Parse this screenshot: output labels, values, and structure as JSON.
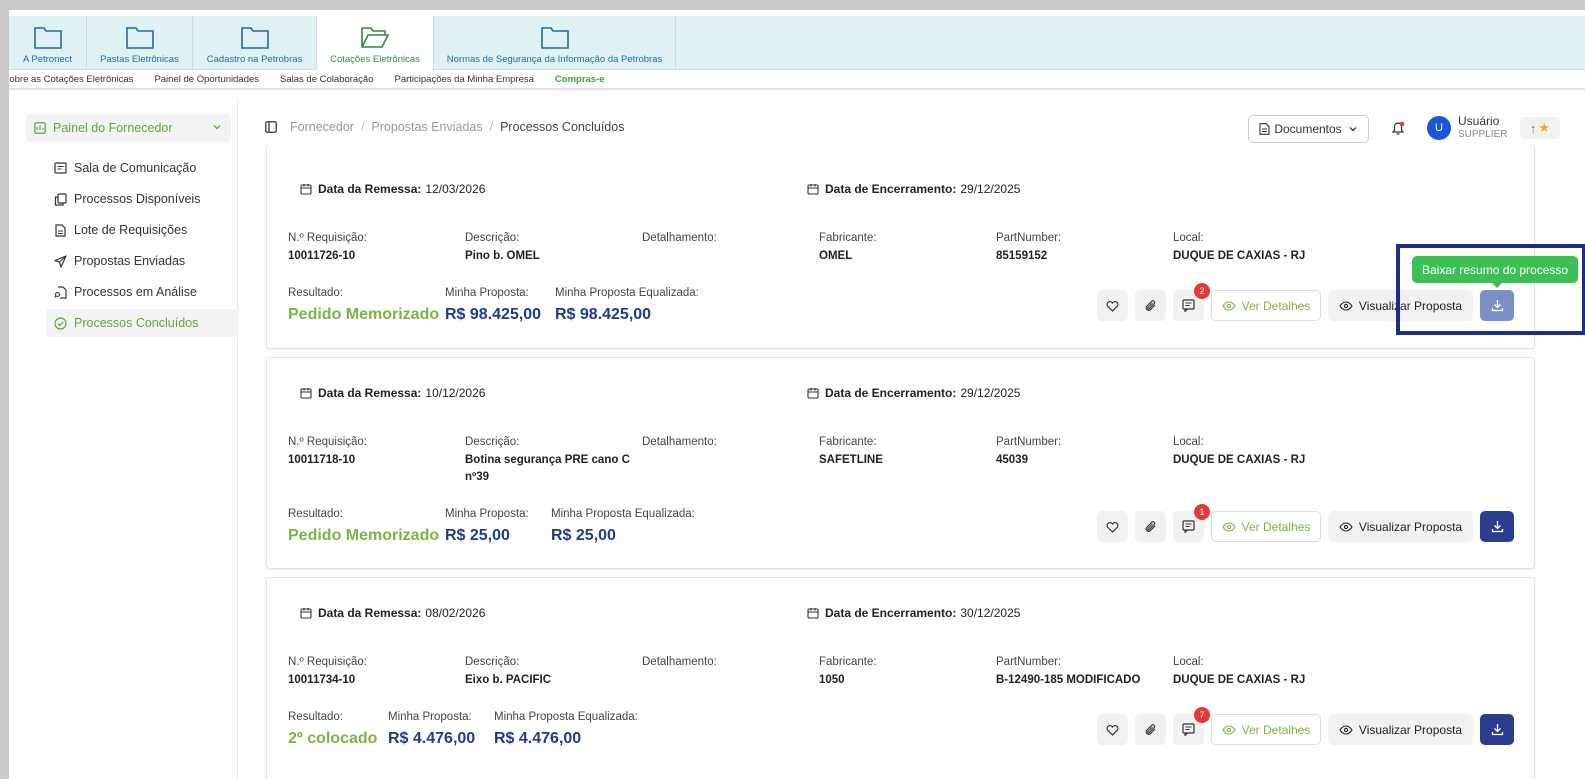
{
  "top_tabs": [
    {
      "label": "A Petronect"
    },
    {
      "label": "Pastas Eletrônicas"
    },
    {
      "label": "Cadastro na Petrobras"
    },
    {
      "label": "Cotações Eletrônicas"
    },
    {
      "label": "Normas de Segurança da Informação da Petrobras"
    }
  ],
  "sub_nav": [
    "Sobre as Cotações Eletrônicas",
    "Painel de Oportunidades",
    "Salas de Colaboração",
    "Participações da Minha Empresa",
    "Compras-e"
  ],
  "sidebar": {
    "header": "Painel do Fornecedor",
    "items": [
      {
        "label": "Sala de Comunicação",
        "icon": "message-square-icon"
      },
      {
        "label": "Processos Disponíveis",
        "icon": "copy-icon"
      },
      {
        "label": "Lote de Requisições",
        "icon": "file-text-icon"
      },
      {
        "label": "Propostas Enviadas",
        "icon": "send-icon"
      },
      {
        "label": "Processos em Análise",
        "icon": "file-search-icon"
      },
      {
        "label": "Processos Concluídos",
        "icon": "check-circle-icon",
        "active": true
      }
    ]
  },
  "breadcrumb": [
    "Fornecedor",
    "Propostas Enviadas",
    "Processos Concluídos"
  ],
  "header": {
    "documents_label": "Documentos",
    "avatar_initial": "U",
    "user_name": "Usuário",
    "user_role": "SUPPLIER"
  },
  "labels": {
    "data_remessa": "Data da Remessa:",
    "data_encerramento": "Data de Encerramento:",
    "requisicao": "N.º Requisição:",
    "descricao": "Descrição:",
    "detalhamento": "Detalhamento:",
    "fabricante": "Fabricante:",
    "partnumber": "PartNumber:",
    "local": "Local:",
    "resultado": "Resultado:",
    "minha_proposta": "Minha Proposta:",
    "minha_proposta_eq": "Minha Proposta Equalizada:",
    "ver_detalhes": "Ver Detalhes",
    "visualizar_proposta": "Visualizar Proposta"
  },
  "cards": [
    {
      "remessa": "12/03/2026",
      "encerramento": "29/12/2025",
      "requisicao": "10011726-10",
      "descricao": "Pino b. OMEL",
      "fabricante": "OMEL",
      "partnumber": "85159152",
      "local": "DUQUE DE CAXIAS - RJ",
      "resultado": "Pedido Memorizado",
      "proposta": "R$ 98.425,00",
      "proposta_eq": "R$ 98.425,00",
      "badge": "2"
    },
    {
      "remessa": "10/12/2026",
      "encerramento": "29/12/2025",
      "requisicao": "10011718-10",
      "descricao": "Botina segurança PRE cano C nº39",
      "fabricante": "SAFETLINE",
      "partnumber": "45039",
      "local": "DUQUE DE CAXIAS - RJ",
      "resultado": "Pedido Memorizado",
      "proposta": "R$ 25,00",
      "proposta_eq": "R$ 25,00",
      "badge": "1"
    },
    {
      "remessa": "08/02/2026",
      "encerramento": "30/12/2025",
      "requisicao": "10011734-10",
      "descricao": "Eixo b. PACIFIC",
      "fabricante": "1050",
      "partnumber": "B-12490-185 MODIFICADO",
      "local": "DUQUE DE CAXIAS - RJ",
      "resultado": "2º colocado",
      "proposta": "R$ 4.476,00",
      "proposta_eq": "R$ 4.476,00",
      "badge": "7"
    }
  ],
  "tooltip": "Baixar resumo do processo"
}
